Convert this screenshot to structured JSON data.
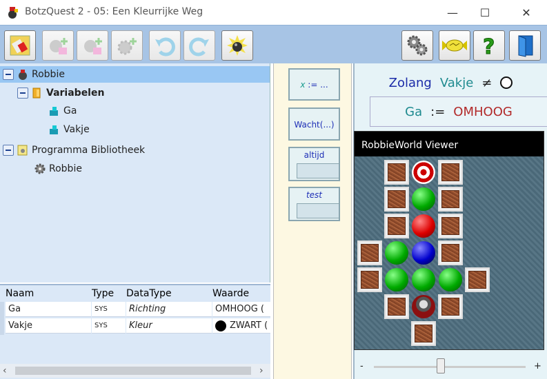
{
  "window": {
    "title": "BotzQuest 2 - 05: Een Kleurrijke Weg",
    "minimize": "—",
    "maximize": "☐",
    "close": "✕"
  },
  "toolbar": {
    "buttons": [
      "save",
      "add-robot",
      "add-variable",
      "add-function",
      "undo",
      "redo",
      "run"
    ],
    "right_buttons": [
      "settings",
      "score",
      "help",
      "exit"
    ]
  },
  "tree": {
    "robot": "Robbie",
    "variables_label": "Variabelen",
    "var1": "Ga",
    "var2": "Vakje",
    "library": "Programma Bibliotheek",
    "lib_item": "Robbie"
  },
  "grid": {
    "headers": [
      "Naam",
      "Type",
      "DataType",
      "Waarde"
    ],
    "rows": [
      {
        "naam": "Ga",
        "type": "SYS",
        "datatype": "Richting",
        "waarde": "OMHOOG ("
      },
      {
        "naam": "Vakje",
        "type": "SYS",
        "datatype": "Kleur",
        "waarde": "ZWART ("
      }
    ],
    "scroll_left": "‹",
    "scroll_right": "›"
  },
  "palette": {
    "assign_var": "x",
    "assign_rest": " := ...",
    "wait": "Wacht(...)",
    "always": "altijd",
    "test": "test"
  },
  "editor": {
    "while_kw": "Zolang",
    "while_var": "Vakje",
    "neq": "≠",
    "assign_var": "Ga",
    "assign_op": ":=",
    "assign_val": "OMHOOG"
  },
  "viewer": {
    "title": "RobbieWorld Viewer"
  },
  "slider": {
    "minus": "-",
    "plus": "+",
    "value": 0.44
  },
  "colors": {
    "toolbar": "#a7c4e5",
    "tree_bg": "#dbe8f7",
    "keyword": "#1b2ba8",
    "var": "#1e8a8f",
    "value": "#b22a2a"
  }
}
